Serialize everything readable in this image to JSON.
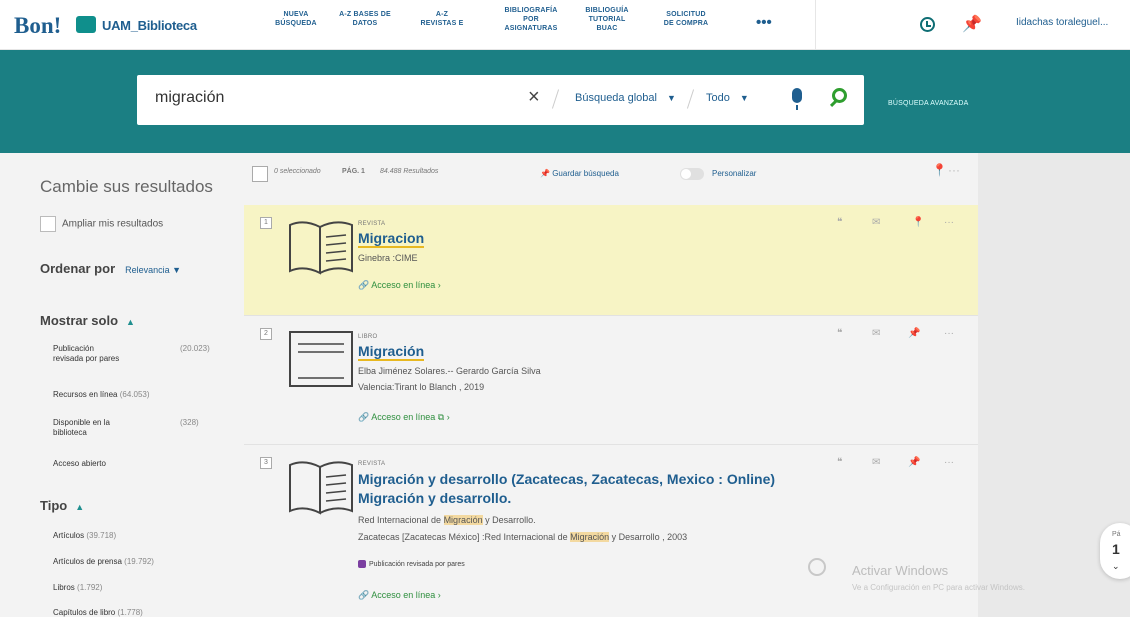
{
  "header": {
    "logo_text": "Bon!",
    "institution": "UAM_Biblioteca",
    "nav": [
      {
        "label": "NUEVA\nBÚSQUEDA"
      },
      {
        "label": "A-Z BASES DE\nDATOS"
      },
      {
        "label": "A-Z\nREVISTAS E"
      },
      {
        "label": "BIBLIOGRAFÍA\nPOR\nASIGNATURAS"
      },
      {
        "label": "BIBLIOGUÍA\nTUTORIAL\nBUAC"
      },
      {
        "label": "SOLICITUD\nDE COMPRA"
      }
    ],
    "more": "•••",
    "user": "Iidachas toraleguel..."
  },
  "search": {
    "query": "migración",
    "clear": "×",
    "scope": "Búsqueda global",
    "scope2": "Todo",
    "advanced": "BÚSQUEDA AVANZADA"
  },
  "sidebar": {
    "title": "Cambie sus resultados",
    "expand": "Ampliar mis resultados",
    "sort_label": "Ordenar por",
    "sort_value": "Relevancia",
    "show_only_title": "Mostrar solo",
    "show_only": [
      {
        "label": "Publicación\nrevisada por pares",
        "count": "(20.023)"
      },
      {
        "label": "Recursos en línea",
        "count": "(64.053)"
      },
      {
        "label": "Disponible en la\nbiblioteca",
        "count": "(328)"
      },
      {
        "label": "Acceso abierto",
        "count": ""
      }
    ],
    "type_title": "Tipo",
    "types": [
      {
        "label": "Artículos",
        "count": "(39.718)"
      },
      {
        "label": "Artículos de prensa",
        "count": "(19.792)"
      },
      {
        "label": "Libros",
        "count": "(1.792)"
      },
      {
        "label": "Capítulos de libro",
        "count": "(1.778)"
      }
    ]
  },
  "toolbar": {
    "selected": "0 seleccionado",
    "page": "PÁG. 1",
    "results": "84.488 Resultados",
    "save": "Guardar búsqueda",
    "customize": "Personalizar"
  },
  "results": [
    {
      "index": "1",
      "type": "REVISTA",
      "title": "Migracion",
      "lines": [
        "Ginebra :CIME"
      ],
      "access": "Acceso en línea"
    },
    {
      "index": "2",
      "type": "LIBRO",
      "title": "Migración",
      "lines": [
        "Elba Jiménez Solares.-- Gerardo García Silva",
        "Valencia:Tirant lo Blanch , 2019"
      ],
      "access": "Acceso en línea"
    },
    {
      "index": "3",
      "type": "REVISTA",
      "title": "Migración y desarrollo (Zacatecas, Zacatecas, Mexico : Online)",
      "subtitle": "Migración y desarrollo.",
      "lines_a": "Red Internacional de ",
      "lines_b": "Migración",
      "lines_c": " y Desarrollo.",
      "line2_a": "Zacatecas [Zacatecas México] :Red Internacional de ",
      "line2_b": "Migración",
      "line2_c": " y Desarrollo , 2003",
      "peer": "Publicación revisada por pares",
      "access": "Acceso en línea"
    }
  ],
  "watermark": {
    "line1": "Activar Windows",
    "line2": "Ve a Configuración en PC para activar Windows."
  },
  "pager": {
    "label": "Pá",
    "value": "1"
  }
}
